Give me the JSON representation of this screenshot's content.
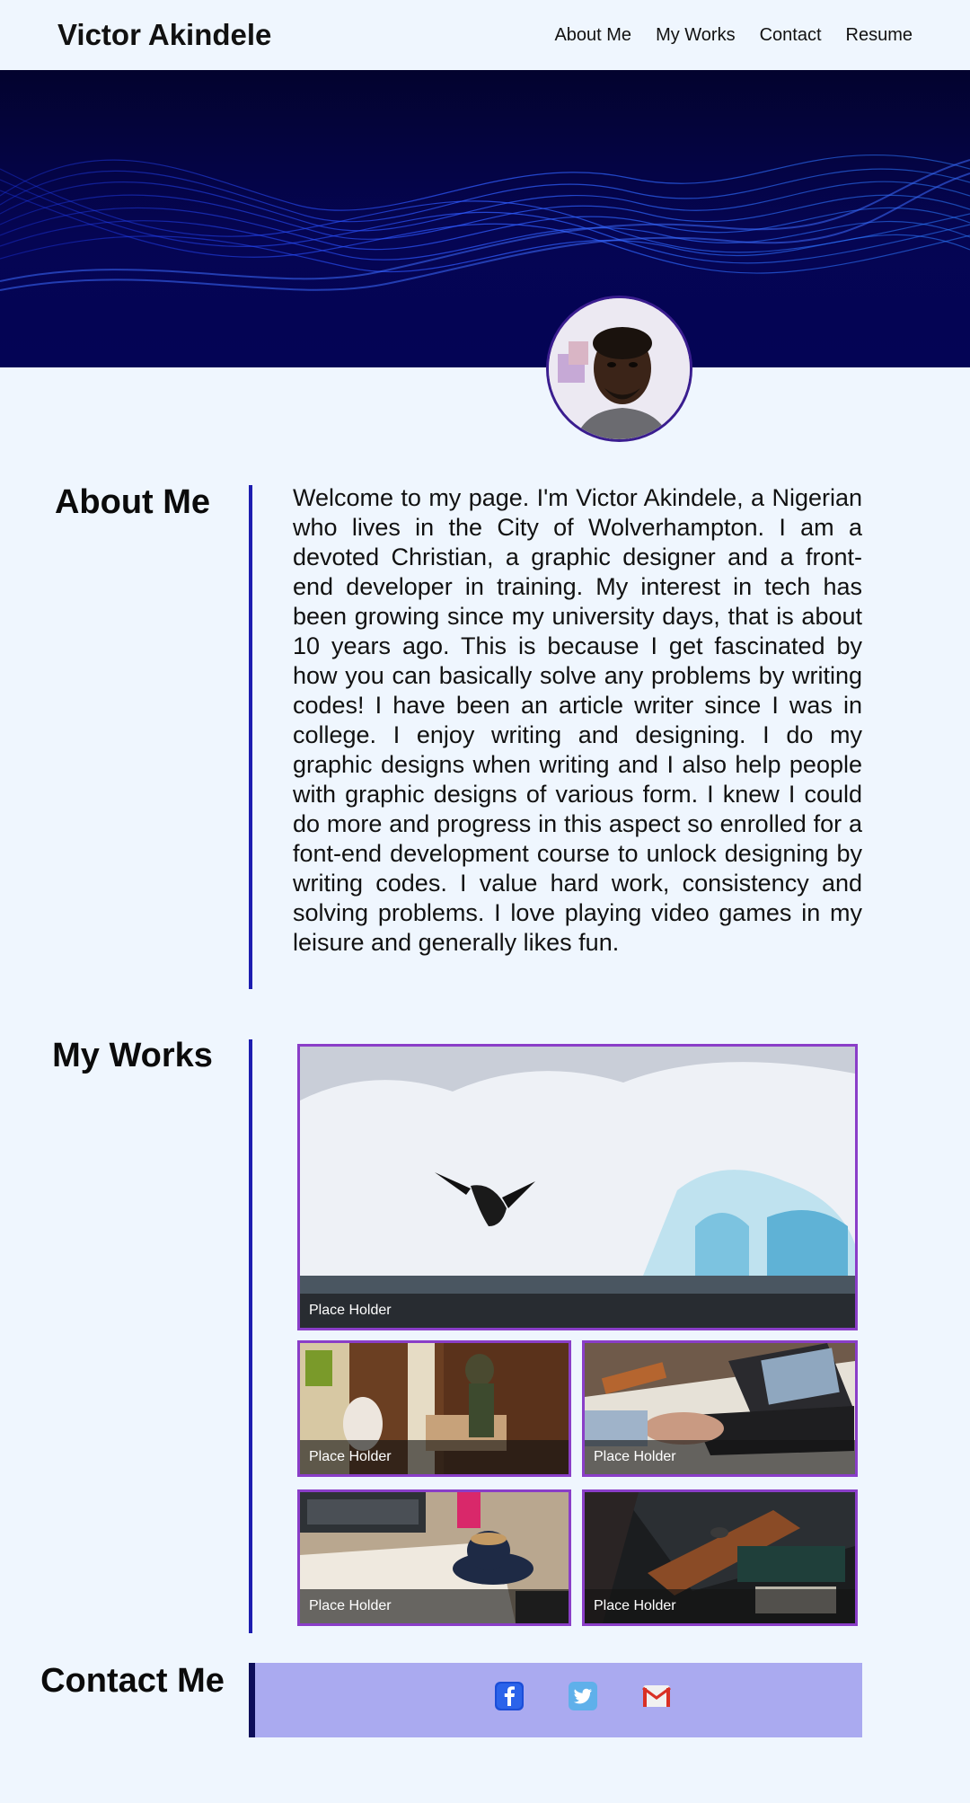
{
  "header": {
    "brand": "Victor Akindele",
    "nav": [
      "About Me",
      "My Works",
      "Contact",
      "Resume"
    ]
  },
  "about": {
    "title": "About Me",
    "text": "Welcome to my page. I'm Victor Akindele, a Nigerian who lives in the City of Wolverhampton. I am a devoted Christian, a graphic designer and a front-end developer in training. My interest in tech has been growing since my university days, that is about 10 years ago. This is because I get fascinated by how you can basically solve any problems by writing codes! I have been an article writer since I was in college. I enjoy writing and designing. I do my graphic designs when writing and I also help people with graphic designs of various form. I knew I could do more and progress in this aspect so enrolled for a font-end development course to unlock designing by writing codes. I value hard work, consistency and solving problems. I love playing video games in my leisure and generally likes fun."
  },
  "works": {
    "title": "My Works",
    "items": [
      {
        "caption": "Place Holder",
        "image": "penguin-iceberg"
      },
      {
        "caption": "Place Holder",
        "image": "people-moving-boxes"
      },
      {
        "caption": "Place Holder",
        "image": "hands-on-laptop"
      },
      {
        "caption": "Place Holder",
        "image": "coffee-notebook-laptop"
      },
      {
        "caption": "Place Holder",
        "image": "desk-setup"
      }
    ]
  },
  "contact": {
    "title": "Contact Me",
    "icons": [
      "facebook-icon",
      "twitter-icon",
      "gmail-icon"
    ]
  },
  "colors": {
    "background": "#eff6fe",
    "accent_line": "#1d1db0",
    "work_border": "#8a3ec8",
    "contact_bar": "#aaaaf0",
    "hero": "#04044a"
  }
}
